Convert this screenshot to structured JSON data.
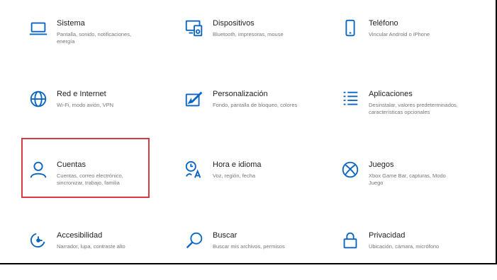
{
  "colors": {
    "accent": "#0a66c2",
    "highlight": "#d63b44",
    "title": "#222222",
    "description": "#767676"
  },
  "tiles": [
    {
      "title": "Sistema",
      "description": "Pantalla, sonido, notificaciones, energía",
      "icon": "laptop-icon"
    },
    {
      "title": "Dispositivos",
      "description": "Bluetooth, impresoras, mouse",
      "icon": "devices-icon"
    },
    {
      "title": "Teléfono",
      "description": "Vincular Android o iPhone",
      "icon": "phone-icon"
    },
    {
      "title": "Red e Internet",
      "description": "Wi-Fi, modo avión, VPN",
      "icon": "globe-icon"
    },
    {
      "title": "Personalización",
      "description": "Fondo, pantalla de bloqueo, colores",
      "icon": "personalization-icon"
    },
    {
      "title": "Aplicaciones",
      "description": "Desinstalar, valores predeterminados, características opcionales",
      "icon": "apps-list-icon"
    },
    {
      "title": "Cuentas",
      "description": "Cuentas, correo electrónico, sincronizar, trabajo, familia",
      "icon": "person-icon",
      "highlighted": true
    },
    {
      "title": "Hora e idioma",
      "description": "Voz, región, fecha",
      "icon": "time-language-icon"
    },
    {
      "title": "Juegos",
      "description": "Xbox Game Bar, capturas, Modo Juego",
      "icon": "xbox-icon"
    },
    {
      "title": "Accesibilidad",
      "description": "Narrador, lupa, contraste alto",
      "icon": "accessibility-icon"
    },
    {
      "title": "Buscar",
      "description": "Buscar mis archivos, permisos",
      "icon": "search-icon"
    },
    {
      "title": "Privacidad",
      "description": "Ubicación, cámara, micrófono",
      "icon": "lock-icon"
    }
  ]
}
